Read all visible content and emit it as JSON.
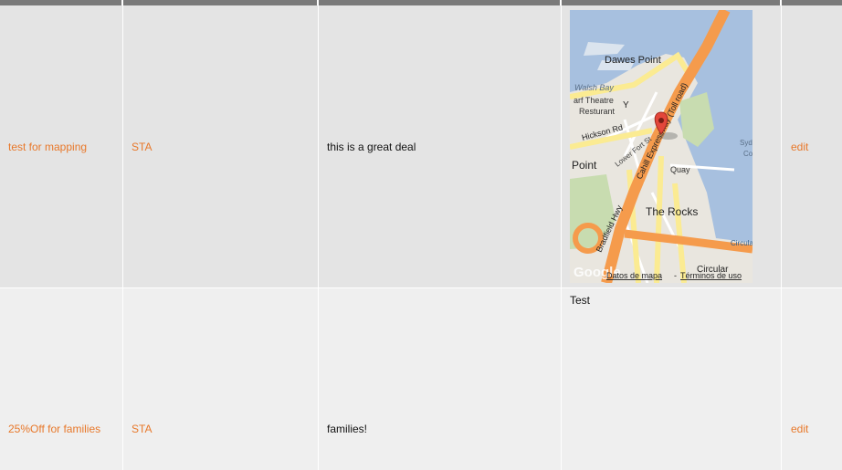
{
  "rows": [
    {
      "title": "test for mapping",
      "code": "STA",
      "description": "this is a great deal",
      "map": {
        "labels": {
          "dawes_point": "Dawes Point",
          "walsh_bay": "Walsh Bay",
          "wharf_theatre": "arf Theatre",
          "restaurant": "Resturant",
          "hickson_rd": "Hickson Rd",
          "lower_fort_st": "Lower Fort St",
          "cahill_expressway": "Cahill Expressway (Toll road)",
          "point": "Point",
          "quay": "Quay",
          "the_rocks": "The Rocks",
          "bradfield_hwy": "Bradfield Hwy",
          "circular": "Circular",
          "circular_quay": "Circular Quay",
          "sydney_partial": "Syd",
          "cove_partial": "Co",
          "logo": "Google",
          "map_data": "Datos de mapa",
          "terms": "Términos de uso",
          "separator": "-"
        },
        "colors": {
          "water": "#a7c0df",
          "land": "#e9e6df",
          "highway": "#f59b4c",
          "major_road": "#fbeb92",
          "park": "#c8dcb0",
          "marker": "#e3463a"
        }
      },
      "action": "edit"
    },
    {
      "title": "25%Off for families",
      "code": "STA",
      "description": "families!",
      "notes": "Test",
      "action": "edit"
    }
  ]
}
